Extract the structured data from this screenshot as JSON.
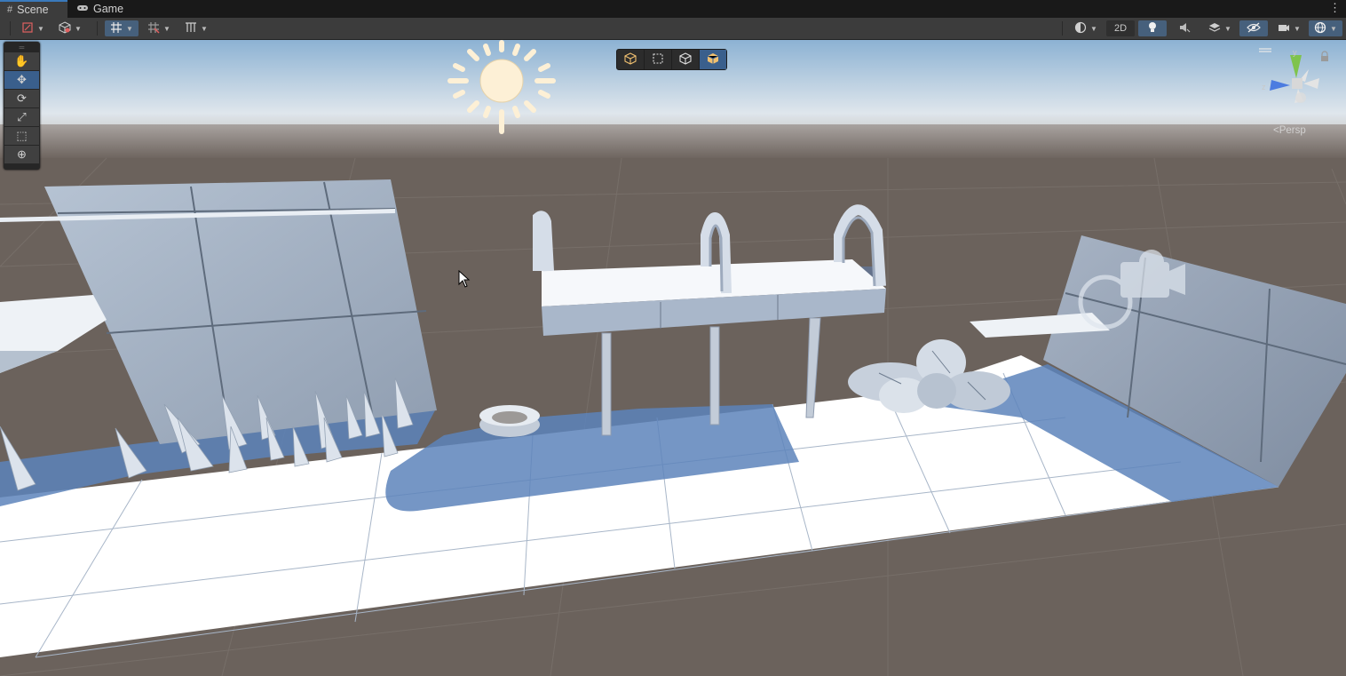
{
  "tabs": [
    {
      "label": "Scene",
      "icon": "grid-icon",
      "active": true
    },
    {
      "label": "Game",
      "icon": "gamepad-icon",
      "active": false
    }
  ],
  "toolbar": {
    "left": [
      {
        "name": "draw-mode",
        "icon": "shading-mode-icon"
      },
      {
        "name": "render-mode",
        "icon": "cube-outline-icon"
      },
      {
        "name": "grid-snap",
        "icon": "grid-snap-icon",
        "selected": true
      },
      {
        "name": "increment-snap",
        "icon": "increment-snap-icon"
      },
      {
        "name": "align",
        "icon": "align-icon"
      }
    ],
    "right": {
      "shading_icon": "sphere-icon",
      "two_d_label": "2D",
      "lighting_icon": "lightbulb-icon",
      "audio_icon": "audio-mute-icon",
      "effects_icon": "layers-icon",
      "visibility_icon": "eye-hidden-icon",
      "camera_icon": "camera-icon",
      "gizmos_icon": "gizmo-globe-icon"
    }
  },
  "tools": [
    {
      "name": "view-tool",
      "icon": "hand-icon",
      "glyph": "✋",
      "selected": false
    },
    {
      "name": "move-tool",
      "icon": "move-icon",
      "glyph": "✥",
      "selected": true
    },
    {
      "name": "rotate-tool",
      "icon": "rotate-icon",
      "glyph": "⟳",
      "selected": false
    },
    {
      "name": "scale-tool",
      "icon": "scale-icon",
      "glyph": "⤢",
      "selected": false
    },
    {
      "name": "rect-tool",
      "icon": "rect-icon",
      "glyph": "⬚",
      "selected": false
    },
    {
      "name": "transform-tool",
      "icon": "transform-icon",
      "glyph": "⊕",
      "selected": false
    }
  ],
  "overlay_tools": [
    {
      "name": "pivot-cube",
      "icon": "cube-icon",
      "selected": false
    },
    {
      "name": "rect-select",
      "icon": "dashed-rect-icon",
      "selected": false
    },
    {
      "name": "cube-wire",
      "icon": "cube-wire-icon",
      "selected": false
    },
    {
      "name": "cube-solid",
      "icon": "cube-solid-icon",
      "selected": true
    }
  ],
  "scene": {
    "projection_label": "Persp",
    "axis_labels": {
      "y": "y",
      "z": "z"
    },
    "colors": {
      "sky_top": "#8fb6d6",
      "sky_horizon": "#dfe7ee",
      "ground": "#6b625c",
      "floor": "#ffffff",
      "shadow": "#5a7fb5",
      "wall": "#9aa8bc",
      "accent": "#3a5f8c"
    },
    "sun_icon": "sun-icon",
    "camera_gizmo_icon": "camera-icon"
  }
}
